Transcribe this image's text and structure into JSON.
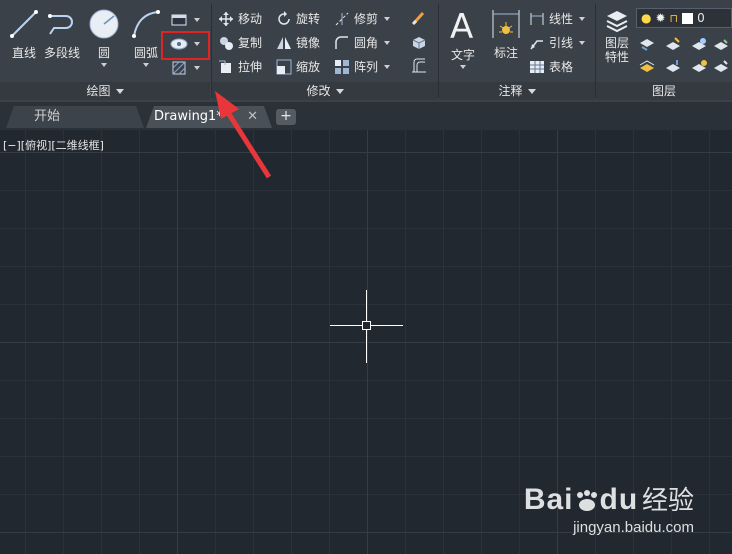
{
  "ribbon": {
    "draw_panel": {
      "title": "绘图",
      "line_label": "直线",
      "polyline_label": "多段线",
      "circle_label": "圆",
      "arc_label": "圆弧"
    },
    "modify_panel": {
      "title": "修改",
      "move_label": "移动",
      "copy_label": "复制",
      "stretch_label": "拉伸",
      "rotate_label": "旋转",
      "mirror_label": "镜像",
      "scale_label": "缩放",
      "trim_label": "修剪",
      "fillet_label": "圆角",
      "array_label": "阵列"
    },
    "annotation_panel": {
      "title": "注释",
      "text_label": "文字",
      "dimension_label": "标注",
      "linear_label": "线性",
      "leader_label": "引线",
      "table_label": "表格"
    },
    "layers_panel": {
      "title": "图层",
      "layer_properties_label_1": "图层",
      "layer_properties_label_2": "特性",
      "current_layer": "0"
    }
  },
  "tabs": [
    {
      "label": "开始"
    },
    {
      "label": "Drawing1*",
      "close": "✕"
    }
  ],
  "new_tab_label": "+",
  "viewport": {
    "label": "[−][俯视][二维线框]"
  },
  "watermark": {
    "logo": "Bai",
    "logo_tail": "du",
    "cn": "经验",
    "url": "jingyan.baidu.com"
  },
  "colors": {
    "ribbon_bg": "#3b4148",
    "canvas_bg": "#212830",
    "highlight": "#e02424",
    "arrow": "#e8363b"
  }
}
